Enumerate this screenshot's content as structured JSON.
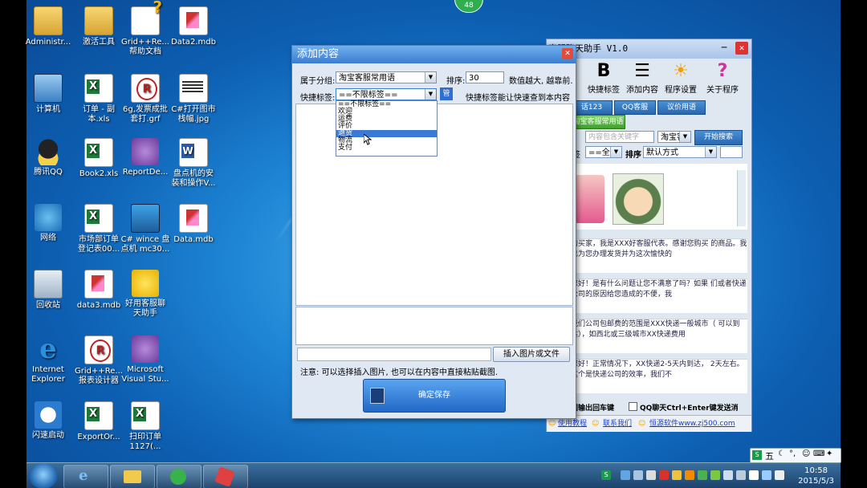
{
  "badge": "48",
  "desktop_icons": [
    {
      "label": "Administr..."
    },
    {
      "label": "激活工具"
    },
    {
      "label": "Grid++Re... 帮助文档"
    },
    {
      "label": "Data2.mdb"
    },
    {
      "label": "计算机"
    },
    {
      "label": "订单 - 副本.xls"
    },
    {
      "label": "6g,发票成批 套打.grf"
    },
    {
      "label": "C#打开图市 栈幅.jpg"
    },
    {
      "label": "腾讯QQ"
    },
    {
      "label": "Book2.xls"
    },
    {
      "label": "ReportDe..."
    },
    {
      "label": "盘点机的安 装和操作V..."
    },
    {
      "label": "网络"
    },
    {
      "label": "市场部订单 登记表00..."
    },
    {
      "label": "C# wince 盘 点机 mc30..."
    },
    {
      "label": "Data.mdb"
    },
    {
      "label": "回收站"
    },
    {
      "label": "data3.mdb"
    },
    {
      "label": "好用客服聊 天助手"
    },
    {
      "label": "Internet Explorer"
    },
    {
      "label": "Grid++Re... 报表设计器"
    },
    {
      "label": "Microsoft Visual Stu..."
    },
    {
      "label": "闪速启动"
    },
    {
      "label": "ExportOr..."
    },
    {
      "label": "扫印订单 1127(..."
    }
  ],
  "app": {
    "title": "客服聊天助手 V1.0",
    "tools": [
      "理",
      "快捷标签",
      "添加内容",
      "程序设置",
      "关于程序"
    ],
    "tabs": [
      "话123",
      "QQ客服",
      "议价用语"
    ],
    "active_tab": "淘宝客服常用语",
    "search_placeholder": "内容包含关键字",
    "search_combo": "淘宝客",
    "search_button": "开始搜索",
    "tag_label": "签",
    "tag_combo": "==全部",
    "sort_label": "排序",
    "sort_combo": "默认方式",
    "messages": [
      "的买家，我是XXX好客服代表。感谢您购买 的商品。我已为您办理发货并为这次愉快的",
      "您好！是有什么问题让您不满意了吗？如果 们或者快递公司的原因给您造成的不便，我",
      "我们公司包邮费的范围是XXX快递一般城市（ 可以到达），如西北或三级城市XX快递费用",
      "您好！正常情况下，XX快递2-5天内到达， 2天左右。这个是快递公司的效率，我们不"
    ],
    "enter_option": "回输出回车键",
    "ctrl_enter_option": "QQ聊天Ctrl+Enter键发送消",
    "footer": [
      "使用教程",
      "联系我们",
      "恒源软件www.zj500.com"
    ]
  },
  "dialog": {
    "title": "添加内容",
    "group_label": "属于分组:",
    "group_value": "淘宝客服常用语",
    "order_label": "排序:",
    "order_value": "30",
    "order_hint": "数值越大, 越靠前.",
    "tag_label": "快捷标签:",
    "tag_value": "==不限标签==",
    "manage_button": "管",
    "tag_hint": "快捷标签能让快速查到本内容",
    "dropdown_options": [
      "==不限标签==",
      "欢迎",
      "运费",
      "评价",
      "退货",
      "物流",
      "支付"
    ],
    "dropdown_highlighted": 4,
    "insert_button": "插入图片或文件",
    "note": "注意: 可以选择插入图片, 也可以在内容中直接粘贴截图.",
    "save_button": "确定保存"
  },
  "taskbar": {
    "ime": "五",
    "time": "10:58",
    "date": "2015/5/3"
  },
  "colors": {
    "desktop": "#1f86d6",
    "title_blue": "#3b7cd0",
    "save_button": "#2f7fd6"
  }
}
